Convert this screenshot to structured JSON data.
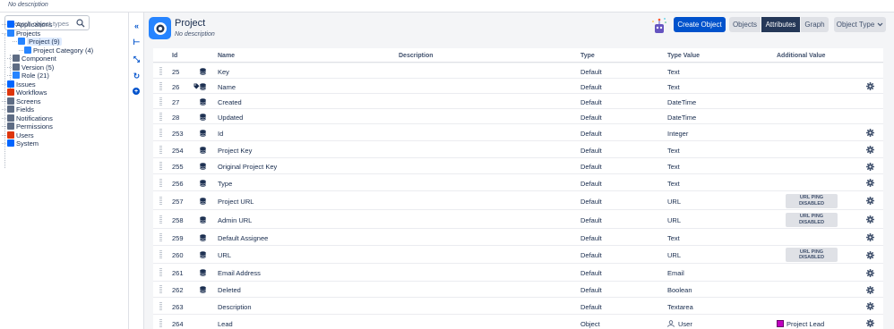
{
  "top": {
    "description": "No description"
  },
  "search": {
    "placeholder": "Search object types"
  },
  "tree": [
    {
      "label": "Applications",
      "icon": "applications-icon",
      "color": "#0065ff"
    },
    {
      "label": "Projects",
      "icon": "projects-icon",
      "color": "#2684ff"
    },
    {
      "label": "Project (9)",
      "icon": "project-icon",
      "color": "#2684ff",
      "selected": true
    },
    {
      "label": "Project Category (4)",
      "icon": "project-category-icon",
      "color": "#2684ff"
    },
    {
      "label": "Component",
      "icon": "component-icon",
      "color": "#5e6c84"
    },
    {
      "label": "Version (5)",
      "icon": "version-icon",
      "color": "#5e6c84"
    },
    {
      "label": "Role (21)",
      "icon": "role-icon",
      "color": "#2684ff"
    },
    {
      "label": "Issues",
      "icon": "issues-icon",
      "color": "#0065ff"
    },
    {
      "label": "Workflows",
      "icon": "workflows-icon",
      "color": "#de350b"
    },
    {
      "label": "Screens",
      "icon": "screens-icon",
      "color": "#5e6c84"
    },
    {
      "label": "Fields",
      "icon": "fields-icon",
      "color": "#5e6c84"
    },
    {
      "label": "Notifications",
      "icon": "notifications-icon",
      "color": "#5e6c84"
    },
    {
      "label": "Permissions",
      "icon": "permissions-icon",
      "color": "#5e6c84"
    },
    {
      "label": "Users",
      "icon": "users-icon",
      "color": "#de350b"
    },
    {
      "label": "System",
      "icon": "system-icon",
      "color": "#0065ff"
    }
  ],
  "rail": [
    "collapse-icon",
    "hierarchy-icon",
    "shrink-icon",
    "refresh-icon",
    "add-icon"
  ],
  "header": {
    "title": "Project",
    "subtitle": "No description",
    "create_button": "Create Object",
    "tabs": [
      "Objects",
      "Attributes",
      "Graph"
    ],
    "active_tab": "Attributes",
    "type_dropdown": "Object Type"
  },
  "columns": {
    "id": "Id",
    "name": "Name",
    "description": "Description",
    "type": "Type",
    "type_value": "Type Value",
    "additional": "Additional Value"
  },
  "rows": [
    {
      "id": "25",
      "name": "Key",
      "type": "Default",
      "type_value": "Text",
      "additional": "",
      "db": true,
      "tag": false,
      "gear": false
    },
    {
      "id": "26",
      "name": "Name",
      "type": "Default",
      "type_value": "Text",
      "additional": "",
      "db": true,
      "tag": true,
      "gear": true
    },
    {
      "id": "27",
      "name": "Created",
      "type": "Default",
      "type_value": "DateTime",
      "additional": "",
      "db": true,
      "tag": false,
      "gear": false
    },
    {
      "id": "28",
      "name": "Updated",
      "type": "Default",
      "type_value": "DateTime",
      "additional": "",
      "db": true,
      "tag": false,
      "gear": false
    },
    {
      "id": "253",
      "name": "Id",
      "type": "Default",
      "type_value": "Integer",
      "additional": "",
      "db": true,
      "tag": false,
      "gear": true
    },
    {
      "id": "254",
      "name": "Project Key",
      "type": "Default",
      "type_value": "Text",
      "additional": "",
      "db": true,
      "tag": false,
      "gear": true
    },
    {
      "id": "255",
      "name": "Original Project Key",
      "type": "Default",
      "type_value": "Text",
      "additional": "",
      "db": true,
      "tag": false,
      "gear": true
    },
    {
      "id": "256",
      "name": "Type",
      "type": "Default",
      "type_value": "Text",
      "additional": "",
      "db": true,
      "tag": false,
      "gear": true
    },
    {
      "id": "257",
      "name": "Project URL",
      "type": "Default",
      "type_value": "URL",
      "additional": "URL PING\nDISABLED",
      "db": true,
      "tag": false,
      "gear": true
    },
    {
      "id": "258",
      "name": "Admin URL",
      "type": "Default",
      "type_value": "URL",
      "additional": "URL PING\nDISABLED",
      "db": true,
      "tag": false,
      "gear": true
    },
    {
      "id": "259",
      "name": "Default Assignee",
      "type": "Default",
      "type_value": "Text",
      "additional": "",
      "db": true,
      "tag": false,
      "gear": true
    },
    {
      "id": "260",
      "name": "URL",
      "type": "Default",
      "type_value": "URL",
      "additional": "URL PING\nDISABLED",
      "db": true,
      "tag": false,
      "gear": true
    },
    {
      "id": "261",
      "name": "Email Address",
      "type": "Default",
      "type_value": "Email",
      "additional": "",
      "db": true,
      "tag": false,
      "gear": true
    },
    {
      "id": "262",
      "name": "Deleted",
      "type": "Default",
      "type_value": "Boolean",
      "additional": "",
      "db": true,
      "tag": false,
      "gear": true
    },
    {
      "id": "263",
      "name": "Description",
      "type": "Default",
      "type_value": "Textarea",
      "additional": "",
      "db": false,
      "tag": false,
      "gear": true
    },
    {
      "id": "264",
      "name": "Lead",
      "type": "Object",
      "type_value": "User",
      "additional": "Project Lead",
      "db": false,
      "tag": false,
      "gear": true,
      "user_icon": true,
      "lead_swatch": "#c000c0"
    }
  ]
}
